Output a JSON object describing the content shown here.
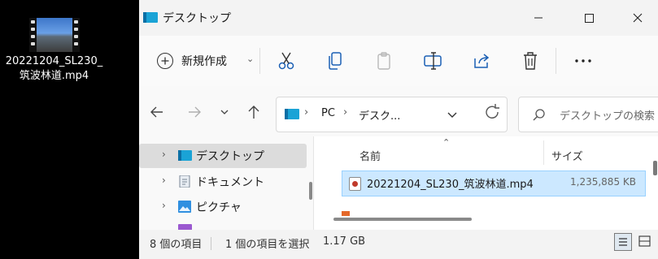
{
  "desktop": {
    "file_label": "20221204_SL230_筑波林道.mp4"
  },
  "window": {
    "title": "デスクトップ",
    "controls": {
      "minimize": "minimize-icon",
      "maximize": "maximize-icon",
      "close": "close-icon"
    }
  },
  "command_bar": {
    "new_label": "新規作成",
    "tools": [
      "cut-icon",
      "copy-icon",
      "paste-icon",
      "rename-icon",
      "share-icon",
      "delete-icon",
      "more-icon"
    ]
  },
  "nav": {
    "breadcrumb": [
      "PC",
      "デスク..."
    ],
    "search_placeholder": "デスクトップの検索"
  },
  "sidebar": {
    "items": [
      {
        "label": "デスクトップ",
        "icon": "desktop-folder-icon",
        "selected": true
      },
      {
        "label": "ドキュメント",
        "icon": "documents-icon",
        "selected": false
      },
      {
        "label": "ピクチャ",
        "icon": "pictures-icon",
        "selected": false
      }
    ]
  },
  "list": {
    "columns": [
      "名前",
      "サイズ"
    ],
    "rows": [
      {
        "name": "20221204_SL230_筑波林道.mp4",
        "size": "1,235,885 KB",
        "selected": true
      }
    ]
  },
  "status": {
    "item_count": "8 個の項目",
    "selected": "1 個の項目を選択",
    "selected_size": "1.17 GB"
  },
  "colors": {
    "selection_bg": "#cce8ff",
    "selection_border": "#99d1ff",
    "accent": "#0a64c8"
  }
}
